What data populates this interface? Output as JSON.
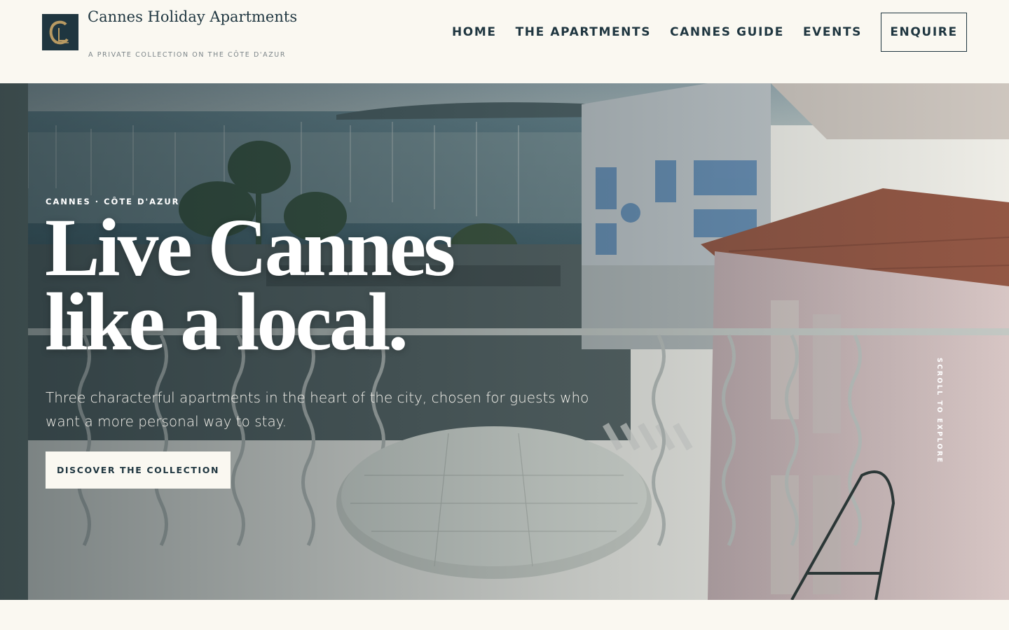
{
  "brand": {
    "name": "Cannes Holiday Apartments",
    "tagline": "A PRIVATE COLLECTION ON THE CÔTE D'AZUR",
    "logo_icon": "cha-monogram-logo",
    "colors": {
      "navy": "#1f3640",
      "gold": "#b89a62",
      "cream": "#faf8f1"
    }
  },
  "nav": {
    "items": [
      {
        "label": "HOME"
      },
      {
        "label": "THE APARTMENTS"
      },
      {
        "label": "CANNES GUIDE"
      },
      {
        "label": "EVENTS"
      }
    ],
    "cta_label": "ENQUIRE"
  },
  "hero": {
    "eyebrow": "CANNES · CÔTE D'AZUR",
    "title_line1": "Live Cannes",
    "title_line2": "like a local.",
    "subtitle": "Three characterful apartments in the heart of the city, chosen for guests who want a more personal way to stay.",
    "cta_label": "DISCOVER THE COLLECTION",
    "scroll_hint": "SCROLL TO EXPLORE",
    "background_image": "balcony-view-over-cannes-harbour"
  }
}
